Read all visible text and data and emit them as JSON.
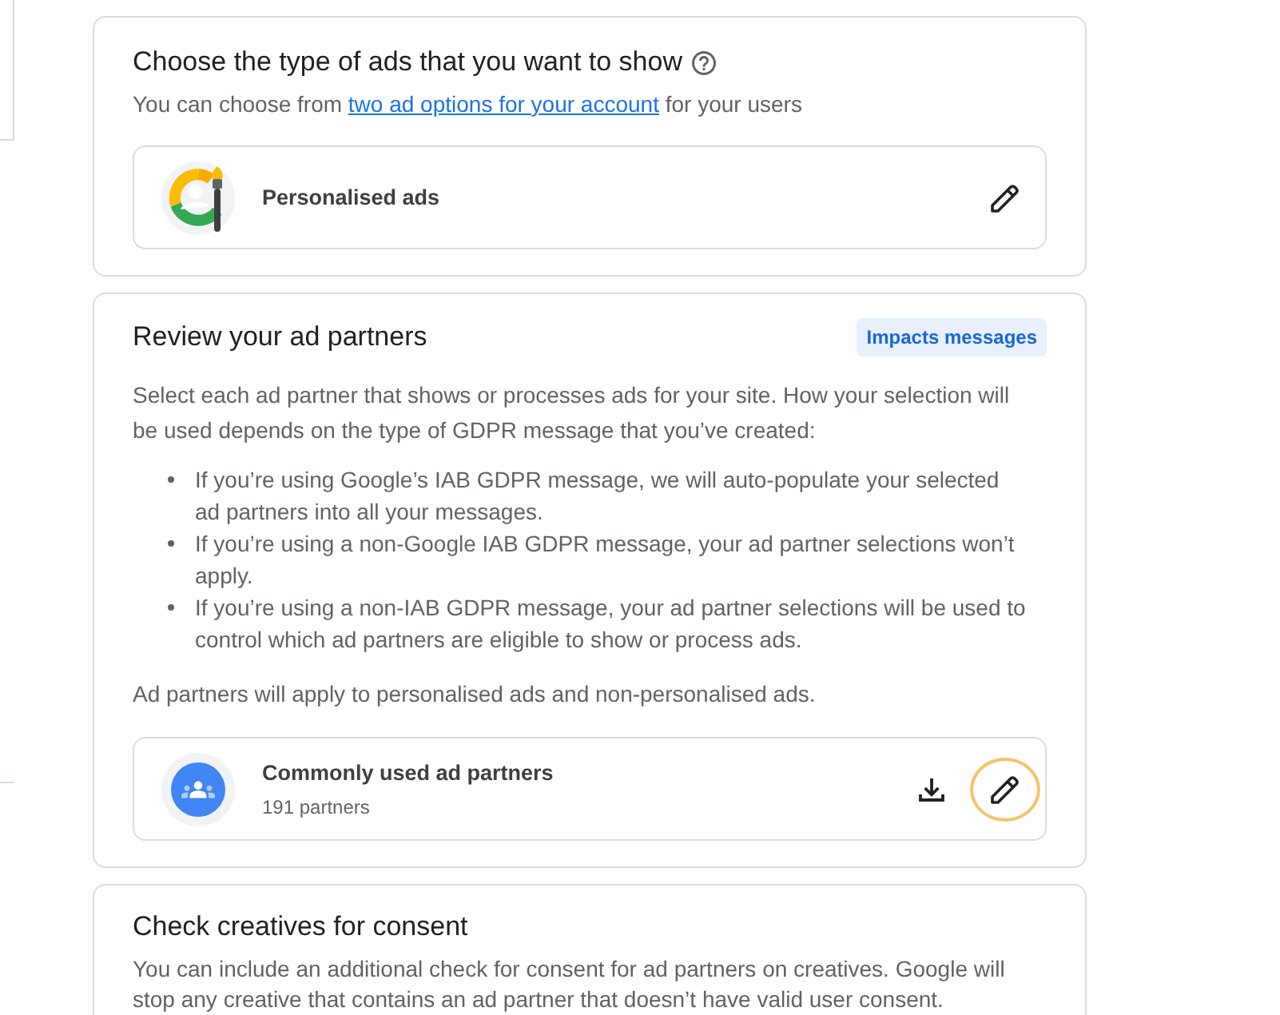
{
  "sections": [
    {
      "title": "Choose the type of ads that you want to show",
      "help": true,
      "blocks": [
        {
          "kind": "linked_text",
          "before": "You can choose from ",
          "link": "two ad options for your account",
          "after": " for your users"
        }
      ],
      "items": [
        {
          "kind": "ad_type",
          "title": "Personalised ads",
          "actions": [
            {
              "kind": "edit",
              "focused": false
            }
          ]
        }
      ]
    },
    {
      "title": "Review your ad partners",
      "help": false,
      "badge": "Impacts messages",
      "blocks": [
        {
          "kind": "text",
          "text": "Select each ad partner that shows or processes ads for your site. How your selection will be used depends on the type of GDPR message that you’ve created:"
        },
        {
          "kind": "bullets",
          "items": [
            "If you’re using Google’s IAB GDPR message, we will auto-populate your selected ad partners into all your messages.",
            "If you’re using a non-Google IAB GDPR message, your ad partner selections won’t apply.",
            "If you’re using a non-IAB GDPR message, your ad partner selections will be used to control which ad partners are eligible to show or process ads."
          ]
        },
        {
          "kind": "text",
          "text": "Ad partners will apply to personalised ads and non-personalised ads."
        }
      ],
      "items": [
        {
          "kind": "partners",
          "title": "Commonly used ad partners",
          "subtitle": "191 partners",
          "actions": [
            {
              "kind": "download",
              "focused": false
            },
            {
              "kind": "edit",
              "focused": true
            }
          ]
        }
      ]
    },
    {
      "title": "Check creatives for consent",
      "help": false,
      "blocks": [
        {
          "kind": "text",
          "text": "You can include an additional check for consent for ad partners on creatives. Google will stop any creative that contains an ad partner that doesn’t have valid user consent."
        }
      ]
    }
  ]
}
